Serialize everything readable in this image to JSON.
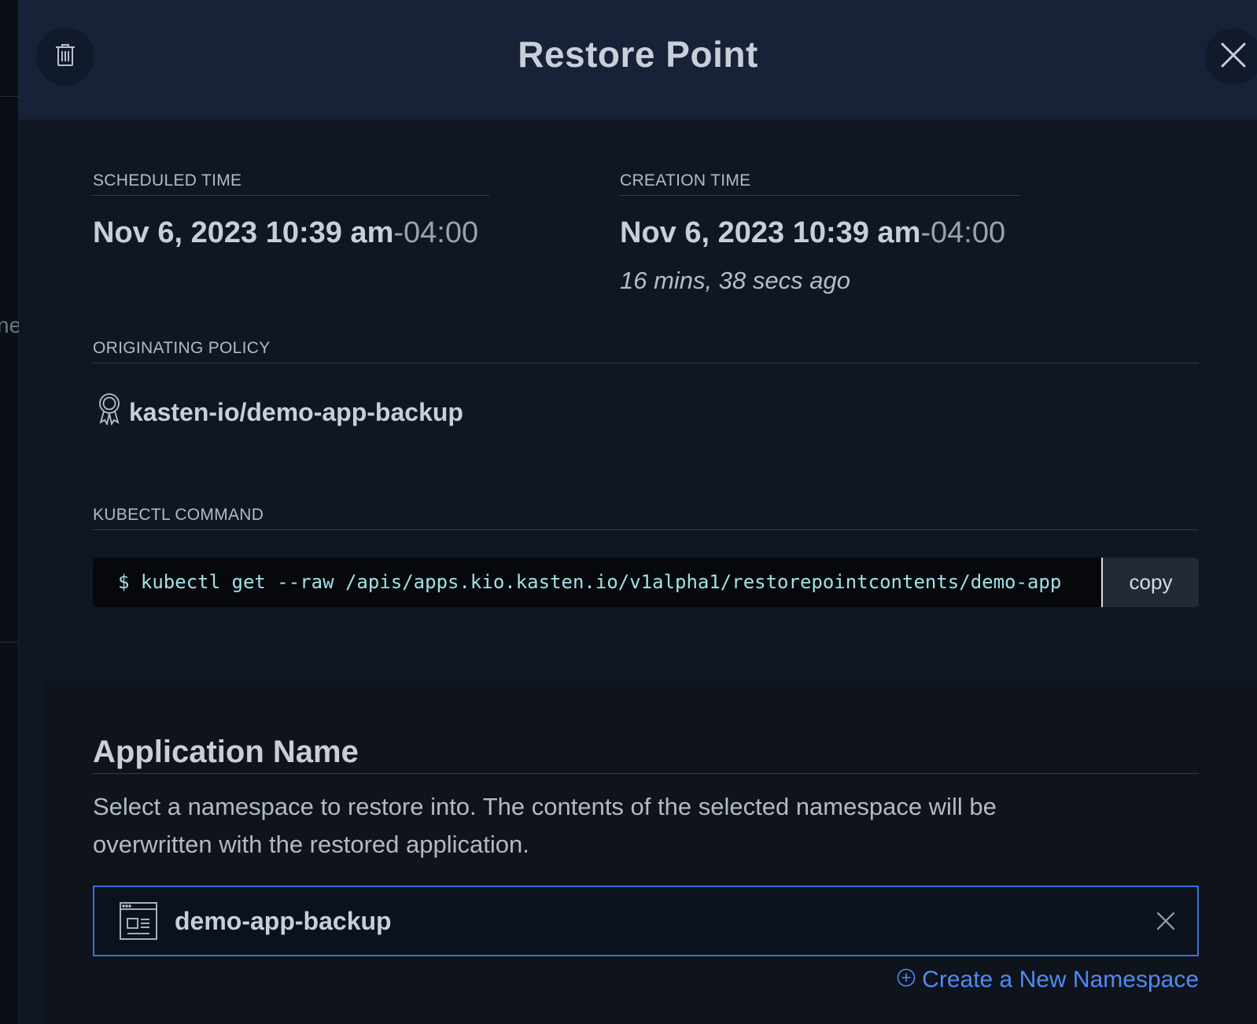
{
  "backdrop": {
    "fragment_text": "ne"
  },
  "header": {
    "title": "Restore Point",
    "delete_icon": "trash-icon",
    "close_icon": "close-icon"
  },
  "scheduled": {
    "label": "SCHEDULED TIME",
    "date": "Nov 6, 2023 10:39 am",
    "tz": "-04:00"
  },
  "creation": {
    "label": "CREATION TIME",
    "date": "Nov 6, 2023 10:39 am",
    "tz": "-04:00",
    "ago": "16 mins, 38 secs ago"
  },
  "policy": {
    "label": "ORIGINATING POLICY",
    "name": "kasten-io/demo-app-backup",
    "icon": "award-ribbon-icon"
  },
  "kubectl": {
    "label": "KUBECTL COMMAND",
    "command": "$ kubectl get --raw /apis/apps.kio.kasten.io/v1alpha1/restorepointcontents/demo-app",
    "copy_label": "copy"
  },
  "application": {
    "title": "Application Name",
    "description": "Select a namespace to restore into. The contents of the selected namespace will be overwritten with the restored application.",
    "selected_namespace": "demo-app-backup",
    "namespace_icon": "namespace-window-icon",
    "create_link": "Create a New Namespace"
  },
  "colors": {
    "header_bg": "#172138",
    "panel_bg": "#111722",
    "accent": "#3a72d6",
    "link": "#4f8cf0",
    "command_text": "#9fe3e8"
  }
}
